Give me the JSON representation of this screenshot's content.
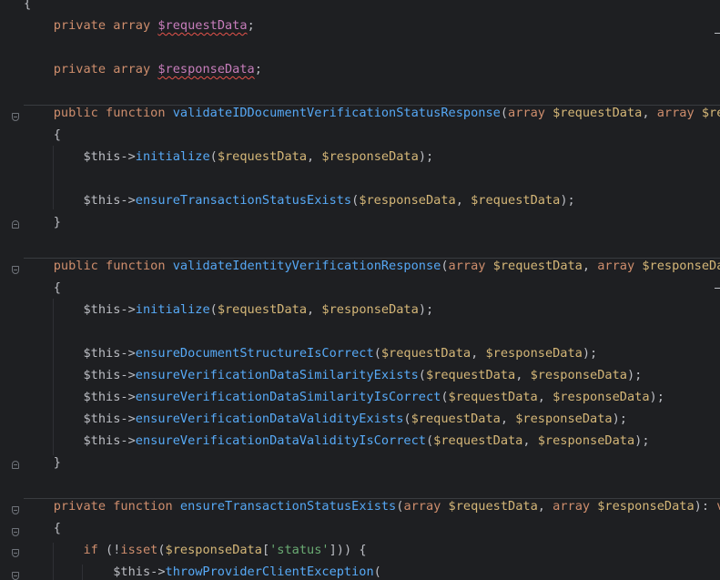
{
  "lines": [
    "{",
    "    private array $requestData;",
    "",
    "    private array $responseData;",
    "",
    "    public function validateIDDocumentVerificationStatusResponse(array $requestData, array $resp",
    "    {",
    "        $this->initialize($requestData, $responseData);",
    "",
    "        $this->ensureTransactionStatusExists($responseData, $requestData);",
    "    }",
    "",
    "    public function validateIdentityVerificationResponse(array $requestData, array $responseData",
    "    {",
    "        $this->initialize($requestData, $responseData);",
    "",
    "        $this->ensureDocumentStructureIsCorrect($requestData, $responseData);",
    "        $this->ensureVerificationDataSimilarityExists($requestData, $responseData);",
    "        $this->ensureVerificationDataSimilarityIsCorrect($requestData, $responseData);",
    "        $this->ensureVerificationDataValidityExists($requestData, $responseData);",
    "        $this->ensureVerificationDataValidityIsCorrect($requestData, $responseData);",
    "    }",
    "",
    "    private function ensureTransactionStatusExists(array $requestData, array $responseData): voi",
    "    {",
    "        if (!isset($responseData['status'])) {",
    "            $this->throwProviderClientException("
  ],
  "colors": {
    "background": "#1e1f22",
    "keyword": "#cf8e6d",
    "property": "#c77dbb",
    "variable": "#d5b778",
    "function_decl": "#56a8f5",
    "method_call": "#57aaf7",
    "string": "#6aab73",
    "default": "#bcbec4",
    "error_underline": "#e5534b"
  },
  "icons": {
    "fold_start": "fold-start-icon",
    "fold_end": "fold-end-icon"
  }
}
